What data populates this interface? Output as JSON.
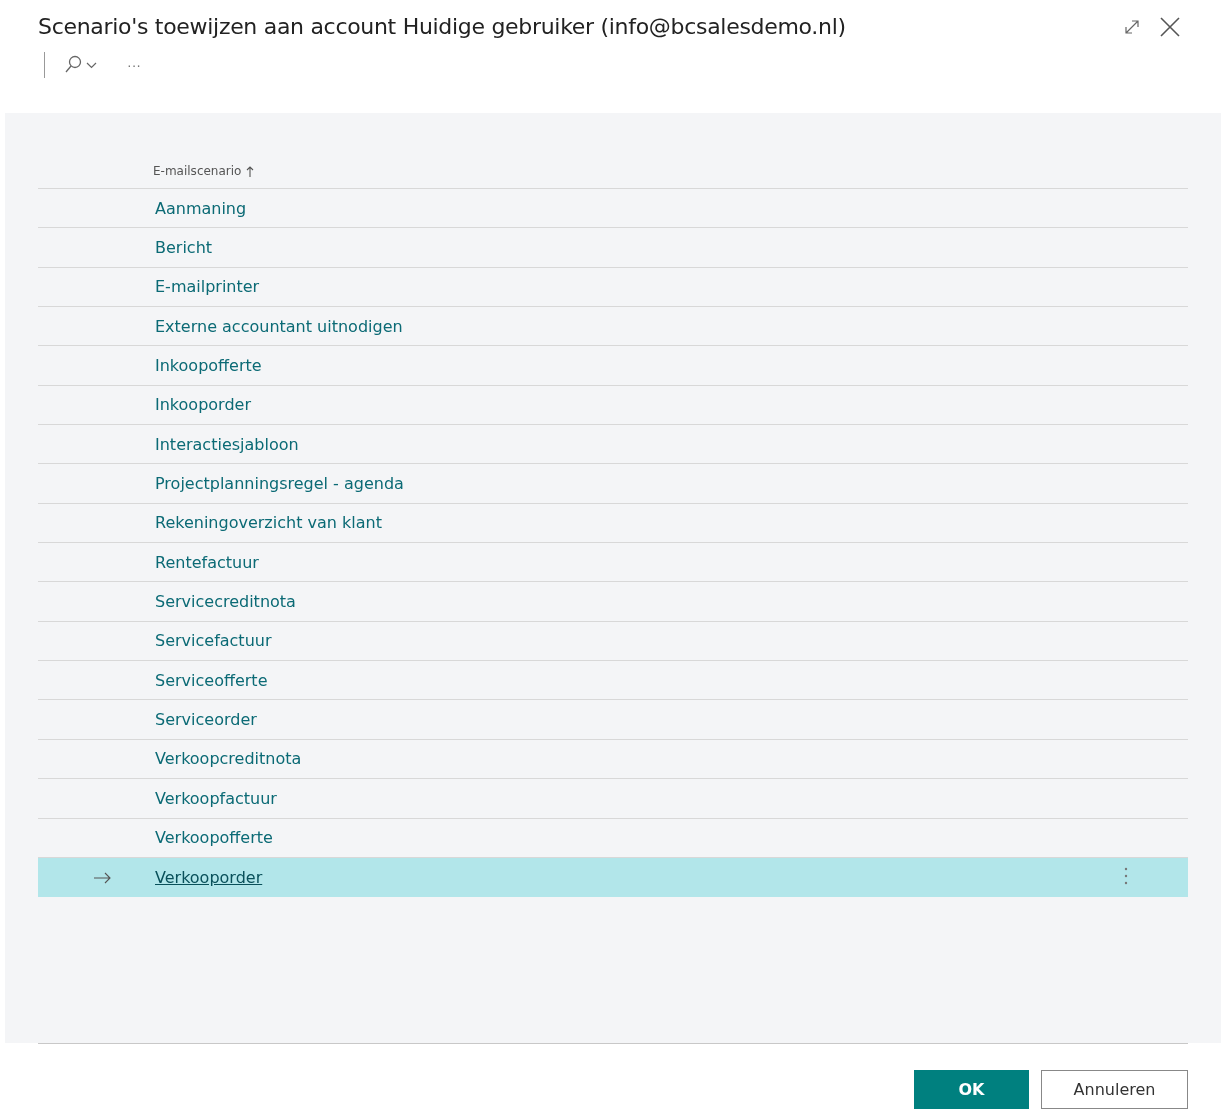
{
  "window": {
    "title": "Scenario's toewijzen aan account Huidige gebruiker (info@bcsalesdemo.nl)"
  },
  "toolbar": {
    "more": "···"
  },
  "table": {
    "columns": [
      {
        "label": "E-mailscenario",
        "sorted_ascending": true
      }
    ],
    "rows": [
      {
        "name": "Aanmaning",
        "selected": false
      },
      {
        "name": "Bericht",
        "selected": false
      },
      {
        "name": "E-mailprinter",
        "selected": false
      },
      {
        "name": "Externe accountant uitnodigen",
        "selected": false
      },
      {
        "name": "Inkoopofferte",
        "selected": false
      },
      {
        "name": "Inkooporder",
        "selected": false
      },
      {
        "name": "Interactiesjabloon",
        "selected": false
      },
      {
        "name": "Projectplanningsregel - agenda",
        "selected": false
      },
      {
        "name": "Rekeningoverzicht van klant",
        "selected": false
      },
      {
        "name": "Rentefactuur",
        "selected": false
      },
      {
        "name": "Servicecreditnota",
        "selected": false
      },
      {
        "name": "Servicefactuur",
        "selected": false
      },
      {
        "name": "Serviceofferte",
        "selected": false
      },
      {
        "name": "Serviceorder",
        "selected": false
      },
      {
        "name": "Verkoopcreditnota",
        "selected": false
      },
      {
        "name": "Verkoopfactuur",
        "selected": false
      },
      {
        "name": "Verkoopofferte",
        "selected": false
      },
      {
        "name": "Verkooporder",
        "selected": true
      }
    ]
  },
  "buttons": [
    {
      "label": "OK",
      "kind": "primary"
    },
    {
      "label": "Annuleren",
      "kind": "secondary"
    }
  ]
}
